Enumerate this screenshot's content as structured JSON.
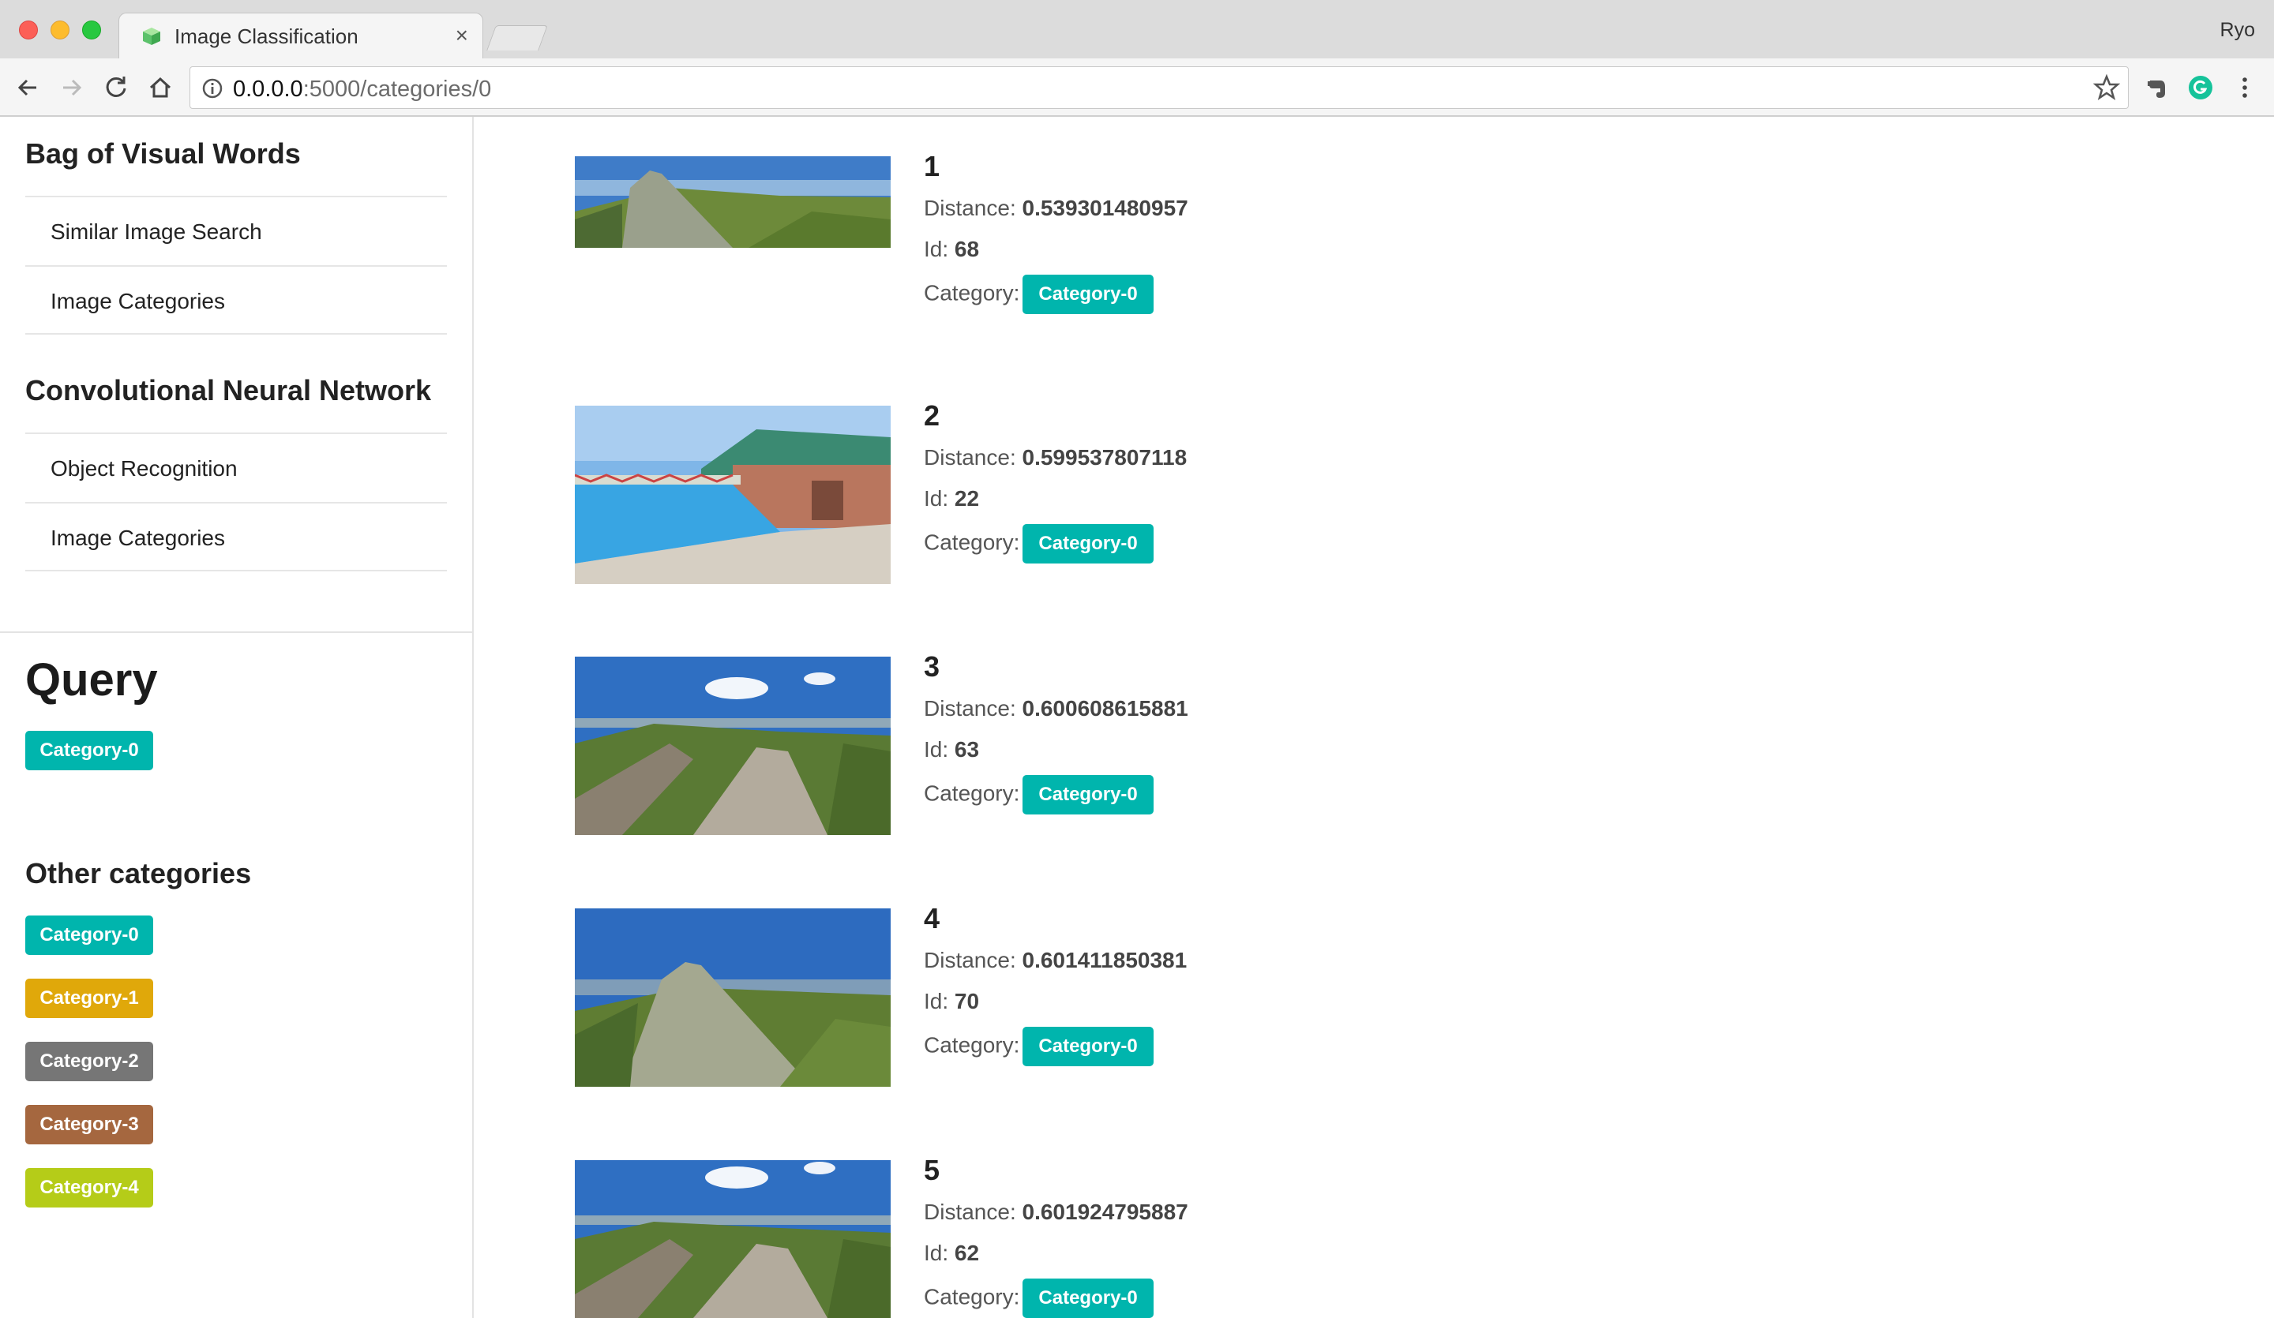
{
  "browser": {
    "tab_title": "Image Classification",
    "tab_close": "×",
    "profile": "Ryo",
    "url_host": "0.0.0.0",
    "url_path": ":5000/categories/0"
  },
  "sidebar": {
    "bovw_title": "Bag of Visual Words",
    "bovw_items": [
      "Similar Image Search",
      "Image Categories"
    ],
    "cnn_title": "Convolutional Neural Network",
    "cnn_items": [
      "Object Recognition",
      "Image Categories"
    ],
    "query_title": "Query",
    "query_label": "Category-0",
    "other_title": "Other categories",
    "other_categories": [
      {
        "name": "Category-0",
        "color": "#00b5ad"
      },
      {
        "name": "Category-1",
        "color": "#e0a80a"
      },
      {
        "name": "Category-2",
        "color": "#767676"
      },
      {
        "name": "Category-3",
        "color": "#a5673f"
      },
      {
        "name": "Category-4",
        "color": "#b5cc18"
      }
    ]
  },
  "result_labels": {
    "distance": "Distance:",
    "id": "Id:",
    "category": "Category:"
  },
  "results": [
    {
      "rank": "1",
      "distance": "0.539301480957",
      "id": "68",
      "category": "Category-0"
    },
    {
      "rank": "2",
      "distance": "0.599537807118",
      "id": "22",
      "category": "Category-0"
    },
    {
      "rank": "3",
      "distance": "0.600608615881",
      "id": "63",
      "category": "Category-0"
    },
    {
      "rank": "4",
      "distance": "0.601411850381",
      "id": "70",
      "category": "Category-0"
    },
    {
      "rank": "5",
      "distance": "0.601924795887",
      "id": "62",
      "category": "Category-0"
    }
  ],
  "colors": {
    "teal": "#00b5ad"
  }
}
